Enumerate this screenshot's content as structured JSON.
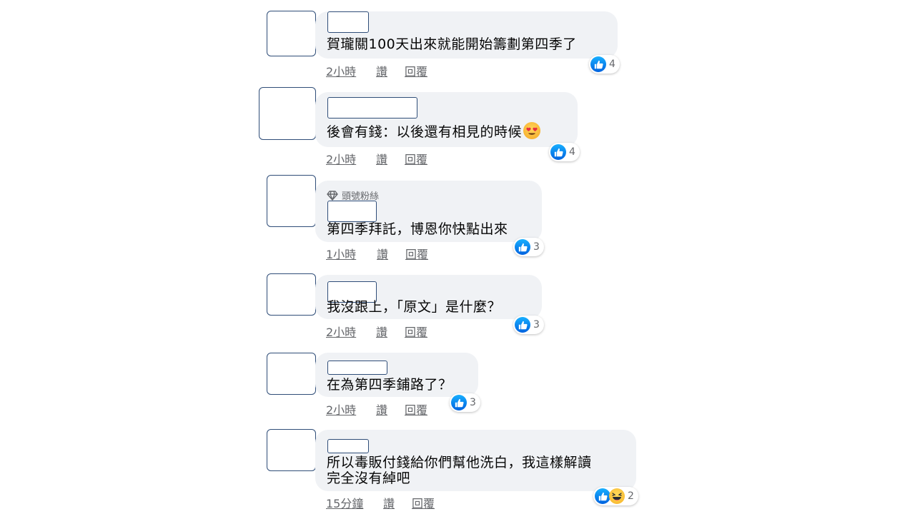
{
  "comments": [
    {
      "text": "賀瓏關100天出來就能開始籌劃第四季了",
      "time": "2小時",
      "like_label": "讚",
      "reply_label": "回覆",
      "reactions": "4"
    },
    {
      "text": "後會有錢：以後還有相見的時候",
      "time": "2小時",
      "like_label": "讚",
      "reply_label": "回覆",
      "reactions": "4",
      "emoji": "heart-eyes-emoji"
    },
    {
      "badge": "頭號粉絲",
      "text": "第四季拜託，博恩你快點出來",
      "time": "1小時",
      "like_label": "讚",
      "reply_label": "回覆",
      "reactions": "3"
    },
    {
      "text": "我沒跟上，「原文」是什麼？",
      "time": "2小時",
      "like_label": "讚",
      "reply_label": "回覆",
      "reactions": "3"
    },
    {
      "text": "在為第四季鋪路了？",
      "time": "2小時",
      "like_label": "讚",
      "reply_label": "回覆",
      "reactions": "3"
    },
    {
      "text_line1": "所以毒販付錢給你們幫他洗白，我這樣解讀",
      "text_line2": "完全沒有綽吧",
      "time": "15分鐘",
      "like_label": "讚",
      "reply_label": "回覆",
      "reactions": "2"
    }
  ],
  "colors": {
    "like_blue": "#1877f2",
    "bubble": "#f0f2f5",
    "meta": "#65676b"
  },
  "icons": {
    "like": "thumbs-up-icon",
    "haha": "laughing-emoji-icon",
    "badge": "diamond-icon"
  }
}
